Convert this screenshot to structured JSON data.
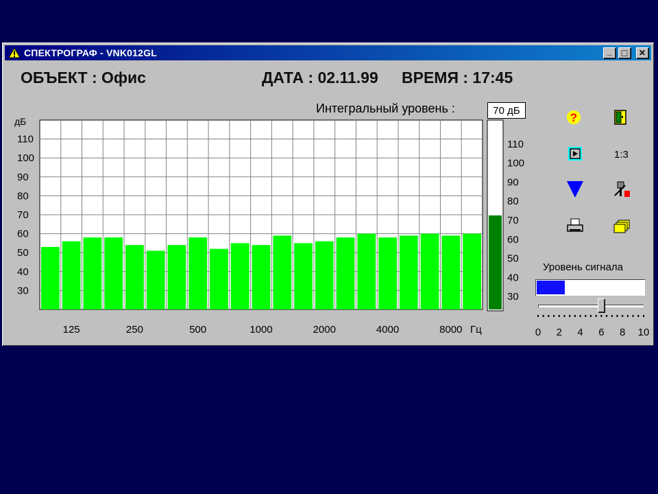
{
  "window": {
    "title": "СПЕКТРОГРАФ - VNK012GL",
    "controls": {
      "minimize": "_",
      "maximize": "□",
      "close": "✕"
    }
  },
  "header": {
    "object_label": "ОБЪЕКТ :",
    "object_value": "Офис",
    "date_label": "ДАТА :",
    "date_value": "02.11.99",
    "time_label": "ВРЕМЯ :",
    "time_value": "17:45"
  },
  "integral": {
    "label": "Интегральный уровень :",
    "value": "70 дБ",
    "level": 70
  },
  "toolbar": {
    "icons": [
      "help-icon",
      "exit-door-icon",
      "play-icon",
      "ratio-label",
      "down-triangle-icon",
      "settings-tool-icon",
      "print-icon",
      "folders-icon"
    ],
    "ratio": "1:3"
  },
  "signal": {
    "label": "Уровень сигнала",
    "level_fraction": 0.26,
    "slider_value": 6,
    "scale_labels": [
      "0",
      "2",
      "4",
      "6",
      "8",
      "10"
    ],
    "scale_range": [
      0,
      10
    ]
  },
  "colors": {
    "bar": "#00ff00",
    "meter_fill": "#008000",
    "title_start": "#000080",
    "title_end": "#1084d0",
    "signal_fill": "#1010ff",
    "desktop": "#000050"
  },
  "chart_data": {
    "type": "bar",
    "ylabel": "дБ",
    "ylim": [
      20,
      120
    ],
    "yticks": [
      30,
      40,
      50,
      60,
      70,
      80,
      90,
      100,
      110
    ],
    "x_tick_labels": [
      "125",
      "250",
      "500",
      "1000",
      "2000",
      "4000",
      "8000"
    ],
    "x_unit": "Гц",
    "grid": true,
    "values": [
      53,
      56,
      58,
      58,
      54,
      51,
      54,
      58,
      52,
      55,
      54,
      59,
      55,
      56,
      58,
      60,
      58,
      59,
      60,
      59,
      60
    ]
  },
  "meter": {
    "ylim": [
      20,
      120
    ],
    "tick_labels": [
      "110",
      "100",
      "90",
      "80",
      "70",
      "60",
      "50",
      "40",
      "30"
    ],
    "value": 70
  }
}
